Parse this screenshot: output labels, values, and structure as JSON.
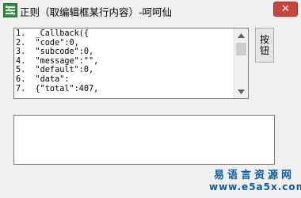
{
  "window": {
    "title": "正则（取编辑框某行内容）-呵呵仙",
    "close_label": "✕"
  },
  "code_box": {
    "lines": [
      "1.  _Callback({",
      "2.  \"code\":0,",
      "3.  \"subcode\":0,",
      "4.  \"message\":\"\",",
      "5.  \"default\":0,",
      "6.  \"data\":",
      "7.  {\"total\":407,"
    ]
  },
  "side_button": {
    "label": "按钮"
  },
  "output_box": {
    "value": ""
  },
  "watermark": {
    "site_name": "易语言资源网",
    "url": "www.e5a5x.com"
  },
  "colors": {
    "close_button": "#c9463d",
    "watermark": "#0f5a9c",
    "background": "#f0f0f0"
  }
}
